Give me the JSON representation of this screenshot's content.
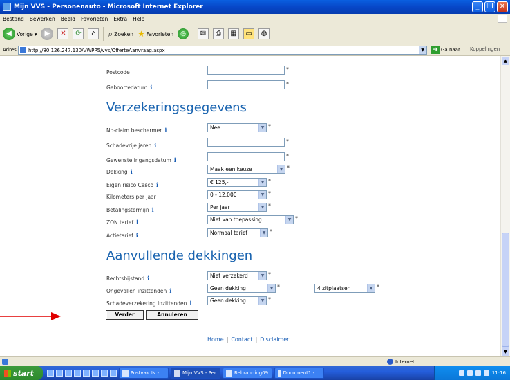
{
  "window": {
    "title": "Mijn VVS - Personenauto - Microsoft Internet Explorer"
  },
  "menu": [
    "Bestand",
    "Bewerken",
    "Beeld",
    "Favorieten",
    "Extra",
    "Help"
  ],
  "toolbar": {
    "back": "Vorige",
    "search": "Zoeken",
    "favorites": "Favorieten"
  },
  "address": {
    "label": "Adres",
    "url": "http://80.126.247.130/VWPP5/vvs/OfferteAanvraag.aspx",
    "go": "Ga naar",
    "links": "Koppelingen"
  },
  "form": {
    "postcode": {
      "label": "Postcode",
      "value": ""
    },
    "geboortedatum": {
      "label": "Geboortedatum",
      "value": ""
    },
    "section1_title": "Verzekeringsgegevens",
    "noclaim": {
      "label": "No-claim beschermer",
      "value": "Nee"
    },
    "schadevrije": {
      "label": "Schadevrije jaren",
      "value": ""
    },
    "ingangsdatum": {
      "label": "Gewenste ingangsdatum",
      "value": ""
    },
    "dekking": {
      "label": "Dekking",
      "value": "Maak een keuze"
    },
    "eigenrisico": {
      "label": "Eigen risico Casco",
      "value": "€ 125,-"
    },
    "kilometers": {
      "label": "Kilometers per jaar",
      "value": "0 - 12.000"
    },
    "betaling": {
      "label": "Betalingstermijn",
      "value": "Per jaar"
    },
    "zon": {
      "label": "ZON tarief",
      "value": "Niet van toepassing"
    },
    "actie": {
      "label": "Actietarief",
      "value": "Normaal tarief"
    },
    "section2_title": "Aanvullende dekkingen",
    "rechtsbijstand": {
      "label": "Rechtsbijstand",
      "value": "Niet verzekerd"
    },
    "ongevallen": {
      "label": "Ongevallen inzittenden",
      "value": "Geen dekking",
      "seats": "4 zitplaatsen"
    },
    "schadeverzekering": {
      "label": "Schadeverzekering Inzittenden",
      "value": "Geen dekking"
    },
    "required": "*",
    "info": "i",
    "btn_next": "Verder",
    "btn_cancel": "Annuleren"
  },
  "footer": {
    "home": "Home",
    "contact": "Contact",
    "disclaimer": "Disclaimer",
    "sep": "|"
  },
  "status": {
    "zone": "Internet"
  },
  "taskbar": {
    "start": "start",
    "tasks": [
      "Postvak IN - ...",
      "Mijn VVS - Per",
      "Rebranding09",
      "Document1 - ..."
    ],
    "clock": "11:16"
  },
  "colors": {
    "heading": "#1a64b0",
    "info": "#1a5eb5",
    "arrow": "#e00000"
  }
}
